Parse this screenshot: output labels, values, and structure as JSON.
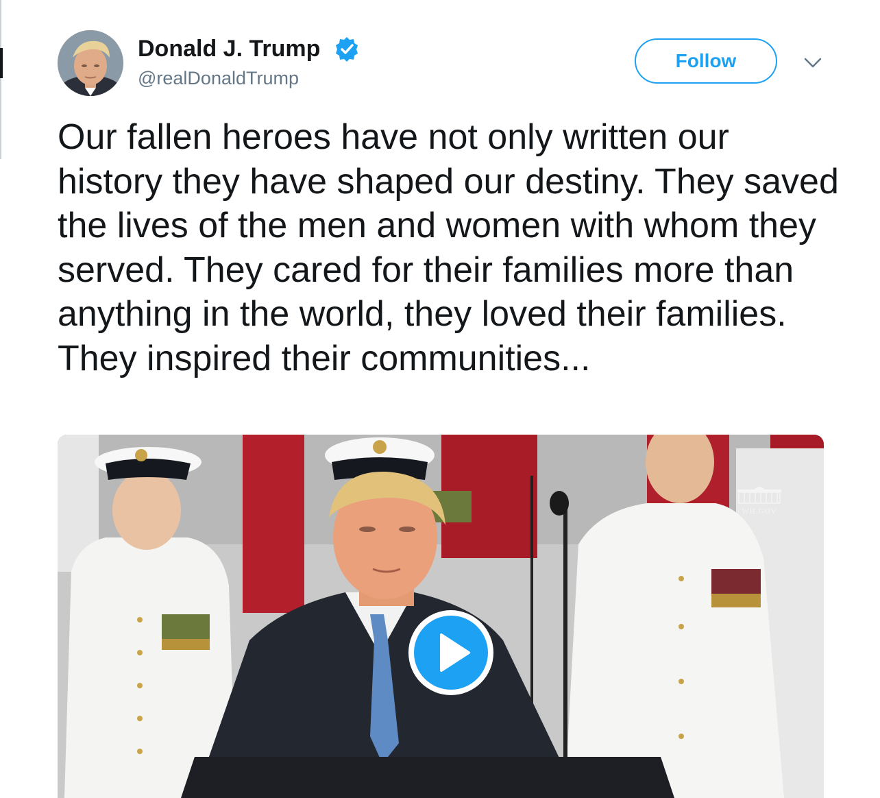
{
  "tweet": {
    "author": {
      "name": "Donald J. Trump",
      "handle": "@realDonaldTrump",
      "verified": true,
      "avatar_icon": "profile-photo"
    },
    "follow_label": "Follow",
    "menu_icon": "chevron-down-icon",
    "text": "Our fallen heroes have not only written our history they have shaped our destiny. They saved the lives of the men and women with whom they served. They cared for their families more than anything in the world, they loved their families. They inspired their communities...",
    "media": {
      "type": "video",
      "watermark": "WH.GOV",
      "play_icon": "play-icon"
    }
  },
  "colors": {
    "accent": "#1da1f2",
    "text": "#14171a",
    "secondary_text": "#657786"
  }
}
